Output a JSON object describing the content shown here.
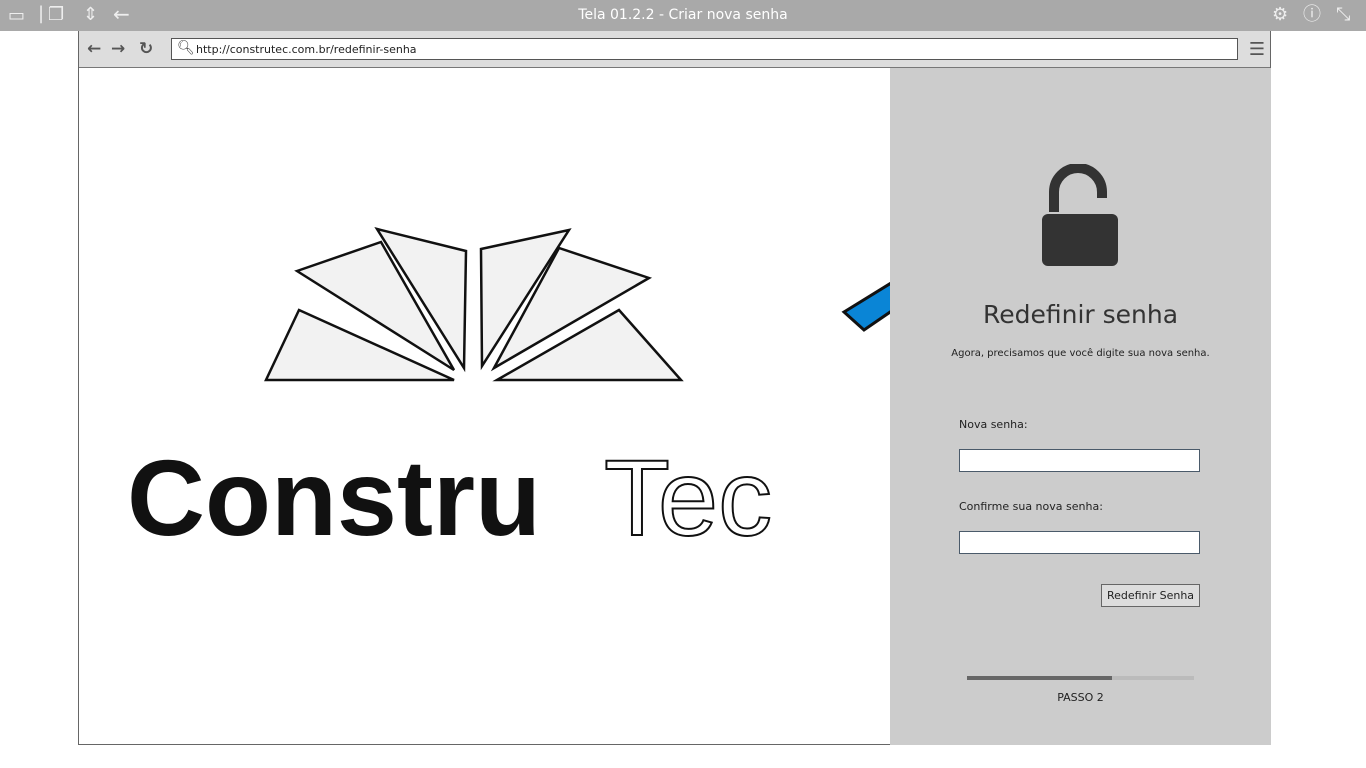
{
  "window": {
    "title": "Tela 01.2.2 - Criar nova senha"
  },
  "browser": {
    "url": "http://construtec.com.br/redefinir-senha"
  },
  "logo": {
    "text_bold": "Constru",
    "text_outline": "Tec"
  },
  "panel": {
    "title": "Redefinir senha",
    "subtitle": "Agora, precisamos que você digite sua nova senha.",
    "new_password_label": "Nova senha:",
    "new_password_value": "",
    "confirm_label": "Confirme sua nova senha:",
    "confirm_value": "",
    "submit_label": "Redefinir Senha",
    "progress": 0.64,
    "step_label": "PASSO 2"
  },
  "colors": {
    "arrow": "#0a85d6",
    "panel": "#cccccc"
  }
}
